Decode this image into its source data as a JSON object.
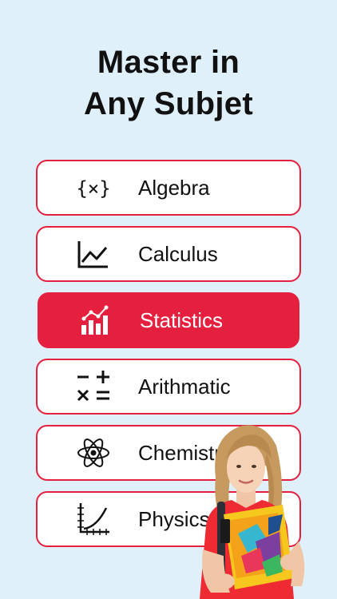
{
  "headline": {
    "line1": "Master in",
    "line2": "Any Subjet"
  },
  "subjects": [
    {
      "label": "Algebra",
      "icon": "variable-x-braces-icon",
      "active": false
    },
    {
      "label": "Calculus",
      "icon": "line-graph-icon",
      "active": false
    },
    {
      "label": "Statistics",
      "icon": "bar-chart-trend-icon",
      "active": true
    },
    {
      "label": "Arithmatic",
      "icon": "math-operators-icon",
      "active": false
    },
    {
      "label": "Chemistry",
      "icon": "atom-icon",
      "active": false
    },
    {
      "label": "Physics",
      "icon": "function-graph-icon",
      "active": false
    }
  ],
  "colors": {
    "accent": "#e5203f",
    "background": "#dff0fb",
    "card": "#ffffff",
    "text": "#111111"
  }
}
